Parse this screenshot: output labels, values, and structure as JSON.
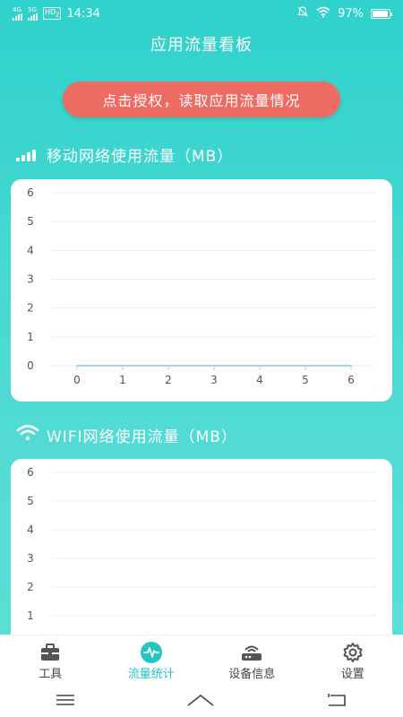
{
  "status_bar": {
    "network_1": "4G",
    "network_2": "5G",
    "hd": "HD",
    "hd_sub": "2",
    "time": "14:34",
    "battery_text": "97%",
    "battery_level": 0.97
  },
  "header": {
    "title": "应用流量看板"
  },
  "auth_button": {
    "label": "点击授权，读取应用流量情况"
  },
  "sections": {
    "mobile": {
      "title": "移动网络使用流量（MB）"
    },
    "wifi": {
      "title": "WIFI网络使用流量（MB）"
    }
  },
  "chart_data": [
    {
      "type": "line",
      "y_ticks": [
        "0",
        "1",
        "2",
        "3",
        "4",
        "5",
        "6"
      ],
      "x_ticks": [
        "0",
        "1",
        "2",
        "3",
        "4",
        "5",
        "6"
      ],
      "ylim": [
        0,
        6
      ],
      "xlim": [
        0,
        6
      ],
      "grid": true,
      "series": [
        {
          "x": [
            0,
            1,
            2,
            3,
            4,
            5,
            6
          ],
          "values": [
            0,
            0,
            0,
            0,
            0,
            0,
            0
          ]
        }
      ]
    },
    {
      "type": "line",
      "y_ticks": [
        "1",
        "2",
        "3",
        "4",
        "5",
        "6"
      ],
      "ylim": [
        0,
        6
      ],
      "grid": true,
      "series": []
    }
  ],
  "bottom_nav": {
    "items": [
      {
        "label": "工具",
        "icon": "toolbox-icon",
        "active": false
      },
      {
        "label": "流量统计",
        "icon": "pulse-icon",
        "active": true
      },
      {
        "label": "设备信息",
        "icon": "router-icon",
        "active": false
      },
      {
        "label": "设置",
        "icon": "gear-icon",
        "active": false
      }
    ]
  },
  "colors": {
    "accent": "#1fc8c3",
    "button": "#ee6b61",
    "background_top": "#2fd2cc",
    "chart_line": "#9fd6ea"
  }
}
